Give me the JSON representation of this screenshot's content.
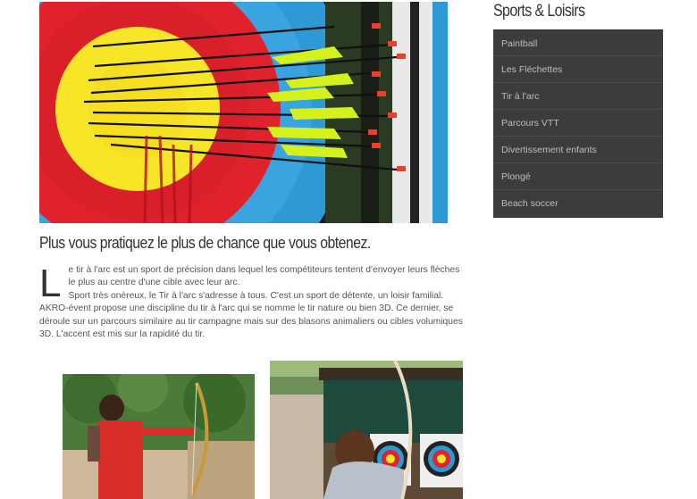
{
  "sidebar": {
    "title": "Sports & Loisirs",
    "items": [
      {
        "label": "Paintball"
      },
      {
        "label": "Les Fléchettes"
      },
      {
        "label": "Tir à l'arc"
      },
      {
        "label": "Parcours VTT"
      },
      {
        "label": "Divertissement enfants"
      },
      {
        "label": "Plongé"
      },
      {
        "label": "Beach soccer"
      }
    ]
  },
  "article": {
    "headline": "Plus vous pratiquez le plus de chance que vous obtenez.",
    "dropcap": "L",
    "intro": "e tir à l'arc est un sport de précision dans lequel les compétiteurs tentent d'envoyer leurs flèches le plus au centre d'une cible avec leur arc.",
    "body": "Sport très onéreux, le Tir à l'arc s'adresse à tous. C'est un sport de détente, un loisir familial. AKRO-évent propose une discipline du tir à l'arc qui se nomme le tir nature ou bien 3D. Ce dernier, se déroule sur un parcours similaire au tir campagne mais sur des blasons animaliers ou cibles volumiques 3D. L'accent est mis sur la rapidité du tir."
  },
  "colors": {
    "sidebar_bg": "#3c3c3c",
    "sidebar_text": "#bdbdbd",
    "heading": "#333333",
    "body_text": "#555555"
  }
}
